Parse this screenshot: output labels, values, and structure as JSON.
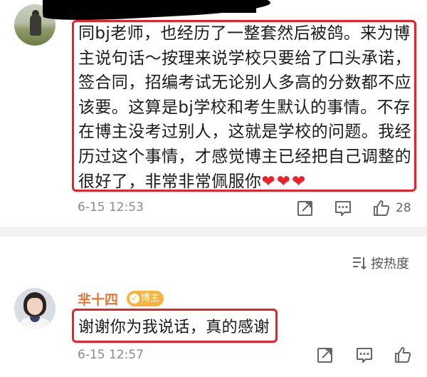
{
  "comment1": {
    "text": "同bj老师，也经历了一整套然后被鸽。来为博主说句话～按理来说学校只要给了口头承诺，签合同，招编考试无论别人多高的分数都不应该要。这算是bj学校和考生默认的事情。不存在博主没考过别人，这就是学校的问题。我经历过这个事情，才感觉博主已经把自己调整的很好了，非常非常佩服你",
    "hearts": "❤❤❤",
    "timestamp": "6-15 12:53",
    "like_count": "28"
  },
  "sort": {
    "label": "按热度"
  },
  "comment2": {
    "username": "芈十四",
    "badge": "博主",
    "text": "谢谢你为我说话，真的感谢",
    "timestamp": "6-15 12:57"
  },
  "icons": {
    "share": "share-icon",
    "comment": "comment-icon",
    "like": "thumbs-up-icon",
    "sort": "sort-icon"
  },
  "colors": {
    "highlight_border": "#e8212a",
    "username": "#e0773a",
    "badge": "#f7b33a",
    "meta_gray": "#8a8a8a"
  }
}
